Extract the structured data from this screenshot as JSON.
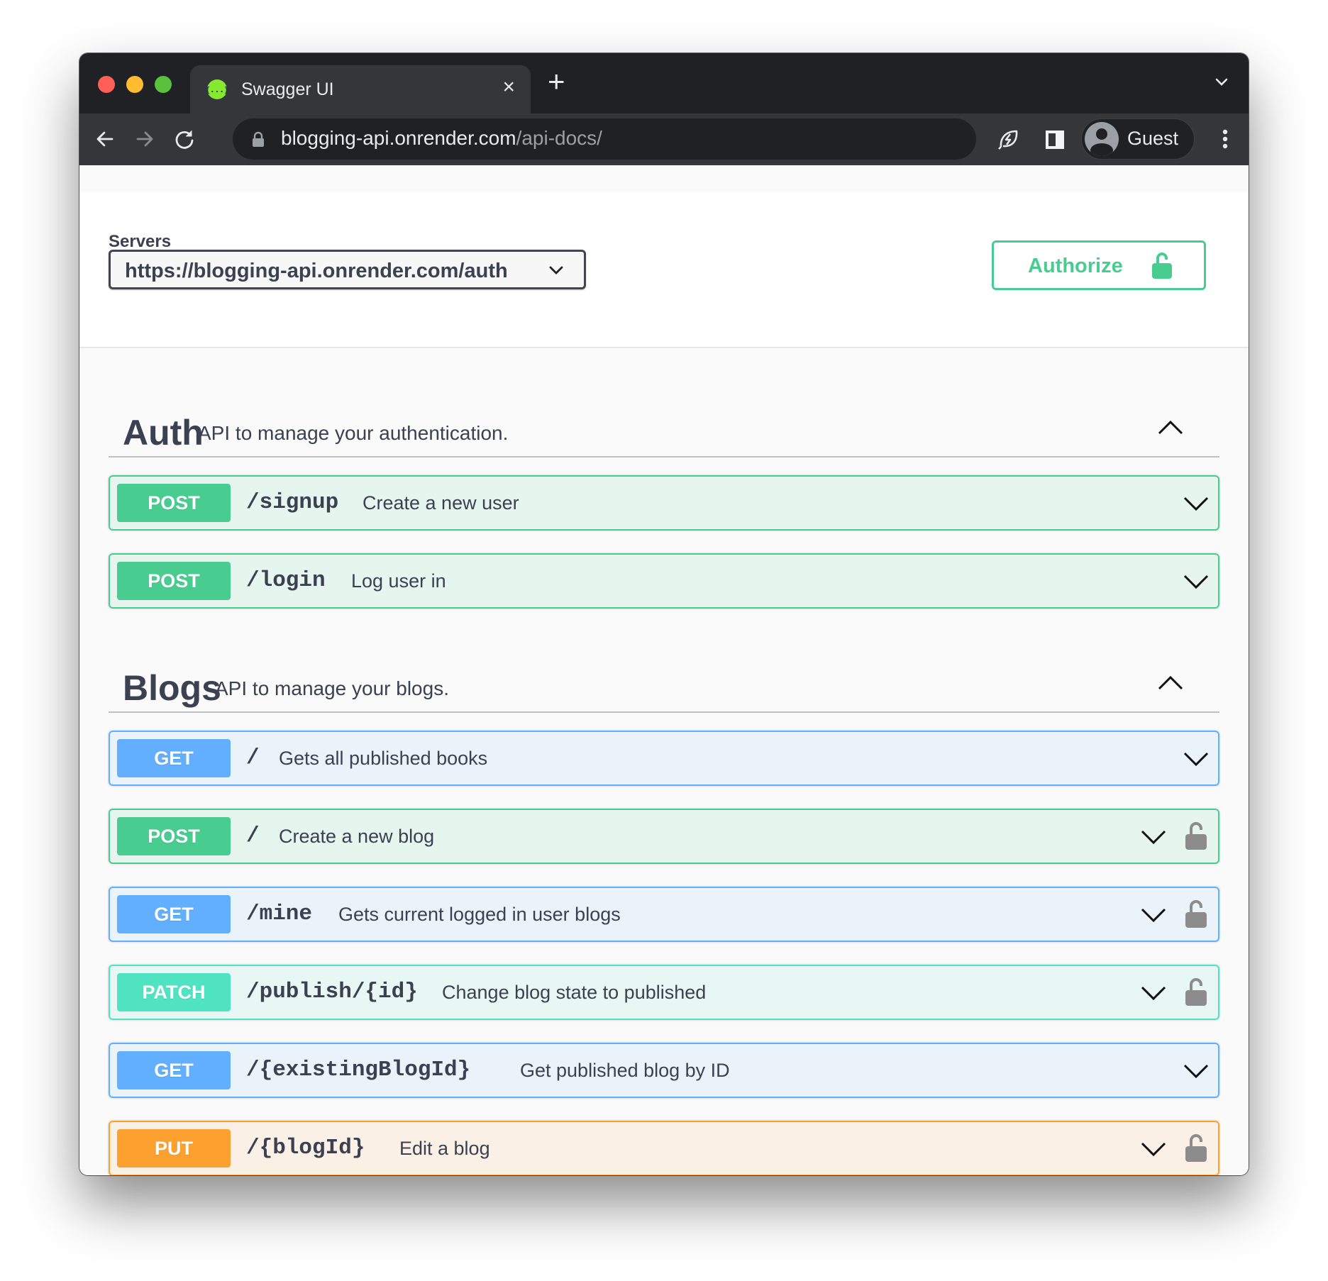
{
  "browser": {
    "tab_title": "Swagger UI",
    "tab_favicon_text": "{...}",
    "new_tab_label": "+",
    "close_label": "×",
    "url_host": "blogging-api.onrender.com",
    "url_path": "/api-docs/",
    "profile_name": "Guest"
  },
  "servers": {
    "label": "Servers",
    "selected": "https://blogging-api.onrender.com/auth"
  },
  "authorize": {
    "label": "Authorize"
  },
  "colors": {
    "post": "#49cc90",
    "get": "#61affe",
    "patch": "#50e3c2",
    "put": "#fca130",
    "text": "#3b4151"
  },
  "sections": [
    {
      "title": "Auth",
      "description": "API to manage your authentication.",
      "expanded": true,
      "operations": [
        {
          "method": "POST",
          "path": "/signup",
          "summary": "Create a new user",
          "locked": false
        },
        {
          "method": "POST",
          "path": "/login",
          "summary": "Log user in",
          "locked": false
        }
      ]
    },
    {
      "title": "Blogs",
      "description": "API to manage your blogs.",
      "expanded": true,
      "operations": [
        {
          "method": "GET",
          "path": "/",
          "summary": "Gets all published books",
          "locked": false
        },
        {
          "method": "POST",
          "path": "/",
          "summary": "Create a new blog",
          "locked": true
        },
        {
          "method": "GET",
          "path": "/mine",
          "summary": "Gets current logged in user blogs",
          "locked": true
        },
        {
          "method": "PATCH",
          "path": "/publish/{id}",
          "summary": "Change blog state to published",
          "locked": true
        },
        {
          "method": "GET",
          "path": "/{existingBlogId}",
          "summary": "Get published blog by ID",
          "locked": false
        },
        {
          "method": "PUT",
          "path": "/{blogId}",
          "summary": "Edit a blog",
          "locked": true
        }
      ]
    }
  ]
}
